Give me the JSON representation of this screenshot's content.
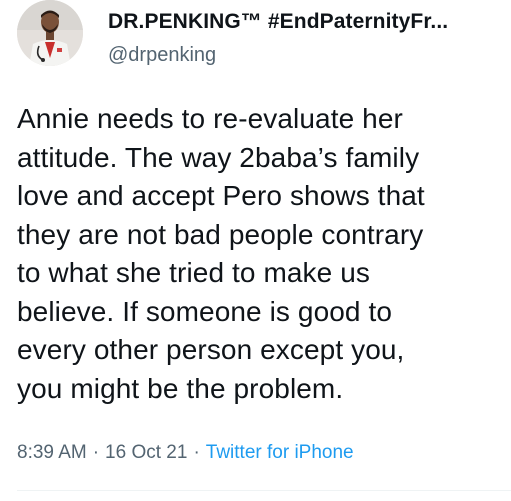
{
  "author": {
    "display_name": "DR.PENKING™ #EndPaternityFr...",
    "handle": "@drpenking"
  },
  "tweet": {
    "text": "Annie needs to re-evaluate her\nattitude. The way 2baba’s family\nlove and accept Pero shows that\nthey are not bad people contrary\nto what she tried to make us\nbelieve. If someone is good to\nevery other person except you,\nyou might be the problem.",
    "time": "8:39 AM",
    "separator": "·",
    "date": "16 Oct 21",
    "source": "Twitter for iPhone"
  },
  "colors": {
    "text": "#0f1419",
    "secondary": "#536471",
    "link": "#1d9bf0"
  },
  "icons": {
    "avatar": "profile-photo"
  }
}
